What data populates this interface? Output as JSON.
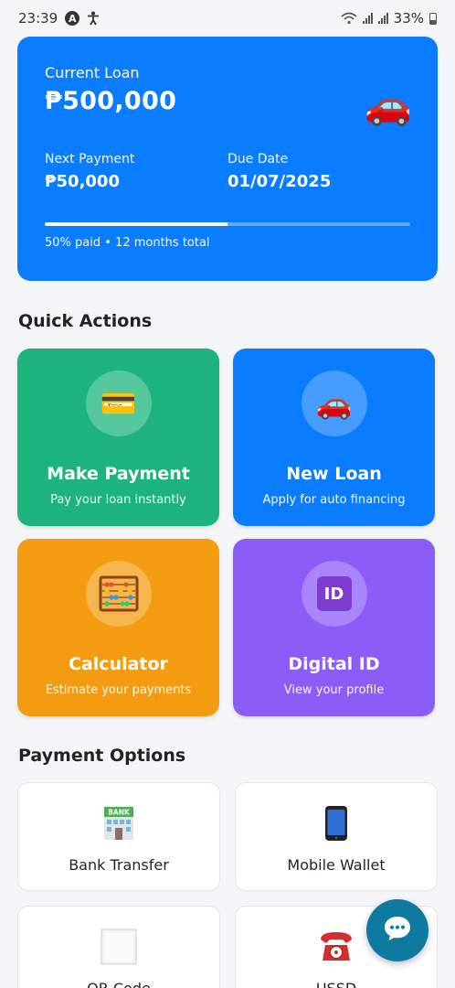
{
  "status_bar": {
    "time": "23:39",
    "battery": "33%",
    "icons": [
      "app-a-icon",
      "accessibility-icon",
      "wifi-icon",
      "signal-icon",
      "signal-icon",
      "battery-icon"
    ]
  },
  "loan_card": {
    "label": "Current Loan",
    "amount": "₱500,000",
    "icon": "car-icon",
    "next_payment_label": "Next Payment",
    "next_payment_value": "₱50,000",
    "due_date_label": "Due Date",
    "due_date_value": "01/07/2025",
    "progress_fraction": 0.5,
    "progress_text": "50% paid • 12 months total",
    "color": "#0a7cff"
  },
  "quick_actions": {
    "title": "Quick Actions",
    "items": [
      {
        "title": "Make Payment",
        "subtitle": "Pay your loan instantly",
        "icon": "credit-card-icon",
        "color": "#1cb47c"
      },
      {
        "title": "New Loan",
        "subtitle": "Apply for auto financing",
        "icon": "car-icon",
        "color": "#0a7cff"
      },
      {
        "title": "Calculator",
        "subtitle": "Estimate your payments",
        "icon": "abacus-icon",
        "color": "#f39c12"
      },
      {
        "title": "Digital ID",
        "subtitle": "View your profile",
        "icon": "id-icon",
        "id_text": "ID",
        "color": "#8b5cf6"
      }
    ]
  },
  "payment_options": {
    "title": "Payment Options",
    "items": [
      {
        "label": "Bank Transfer",
        "icon": "bank-icon",
        "icon_text": "BANK"
      },
      {
        "label": "Mobile Wallet",
        "icon": "mobile-phone-icon"
      },
      {
        "label": "QR Code",
        "icon": "qr-code-icon"
      },
      {
        "label": "USSD",
        "icon": "telephone-icon"
      }
    ]
  },
  "fab": {
    "icon": "chat-bubble-icon",
    "color": "#0e7aa0"
  }
}
